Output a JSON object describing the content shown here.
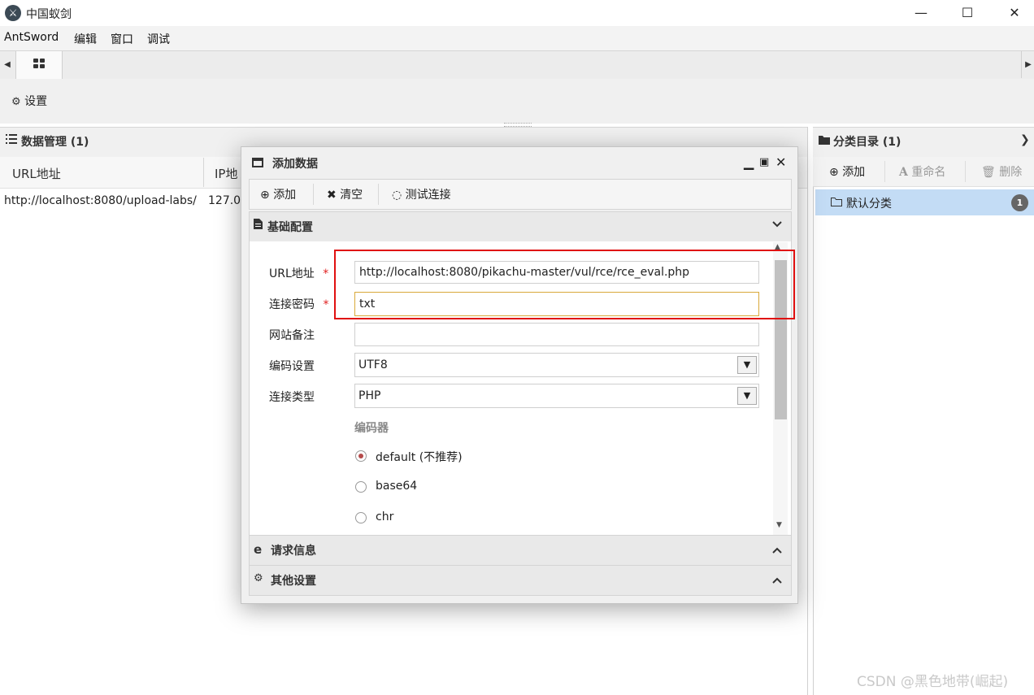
{
  "window": {
    "title": "中国蚁剑",
    "minimize": "—",
    "maximize": "☐",
    "close": "✕"
  },
  "menu": [
    "AntSword",
    "编辑",
    "窗口",
    "调试"
  ],
  "toolbar": {
    "settings_label": "设置"
  },
  "data_panel": {
    "title": "数据管理 (1)",
    "columns": [
      "URL地址",
      "IP地"
    ],
    "rows": [
      {
        "url": "http://localhost:8080/upload-labs/",
        "ip": "127.0"
      }
    ]
  },
  "category_panel": {
    "title": "分类目录 (1)",
    "add_label": "添加",
    "rename_label": "重命名",
    "delete_label": "删除",
    "items": [
      {
        "label": "默认分类",
        "count": "1"
      }
    ]
  },
  "dialog": {
    "title": "添加数据",
    "toolbar": {
      "add": "添加",
      "clear": "清空",
      "test": "测试连接"
    },
    "sections": {
      "basic": "基础配置",
      "request": "请求信息",
      "other": "其他设置"
    },
    "form": {
      "url_label": "URL地址",
      "url_value": "http://localhost:8080/pikachu-master/vul/rce/rce_eval.php",
      "password_label": "连接密码",
      "password_value": "txt",
      "note_label": "网站备注",
      "note_value": "",
      "encoding_label": "编码设置",
      "encoding_value": "UTF8",
      "type_label": "连接类型",
      "type_value": "PHP",
      "encoder_label": "编码器",
      "encoders": [
        {
          "label": "default (不推荐)",
          "selected": true
        },
        {
          "label": "base64",
          "selected": false
        },
        {
          "label": "chr",
          "selected": false
        }
      ],
      "required_mark": "*"
    }
  },
  "watermark": "CSDN @黑色地带(崛起)",
  "colors": {
    "selection": "#c3dcf5",
    "highlight_box": "#e01010",
    "required": "#e02020"
  }
}
